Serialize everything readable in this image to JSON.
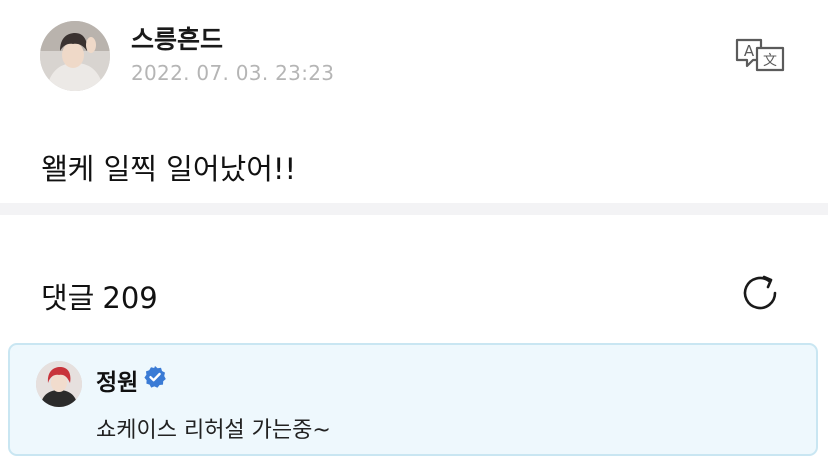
{
  "post": {
    "author": "스릉흔드",
    "timestamp": "2022. 07. 03. 23:23",
    "body": "왤케 일찍 일어났어!!",
    "avatar_icon": "profile-photo",
    "translate_icon": "translate-icon"
  },
  "comments": {
    "label": "댓글",
    "count": "209",
    "refresh_icon": "refresh-icon"
  },
  "pinned_comment": {
    "author": "정원",
    "verified_icon": "verified-badge-icon",
    "text": "쇼케이스 리허설 가는중~"
  },
  "colors": {
    "timestamp": "#b5b5b5",
    "divider": "#f3f3f5",
    "card_background": "#eef8fd",
    "card_border": "#c9e6f2",
    "verified": "#3a7bd5"
  }
}
